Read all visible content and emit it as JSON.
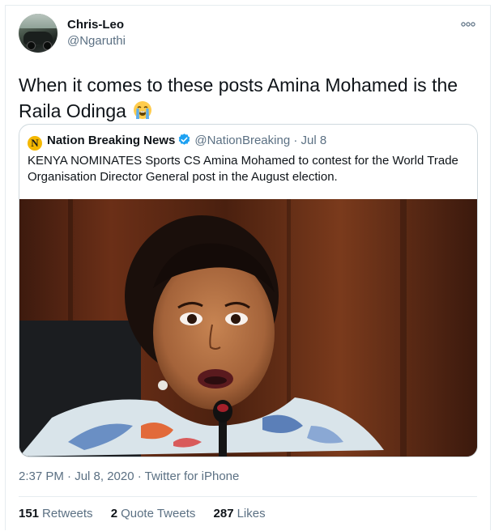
{
  "tweet": {
    "author": {
      "display_name": "Chris-Leo",
      "handle": "@Ngaruthi",
      "avatar_icon": "avatar-car-photo"
    },
    "more_icon": "more-dots-icon",
    "text": "When it comes to these posts Amina Mohamed is the Raila Odinga",
    "emoji": "loudly-crying-face",
    "quoted": {
      "logo_letter": "N",
      "display_name": "Nation Breaking News",
      "verified": true,
      "handle": "@NationBreaking",
      "separator": "·",
      "date": "Jul 8",
      "text": "KENYA NOMINATES Sports CS Amina Mohamed to contest for the World Trade Organisation Director General post in the August election.",
      "photo": "photo of woman speaking into microphone"
    },
    "timestamp": "2:37 PM · Jul 8, 2020 · Twitter for iPhone",
    "stats": {
      "retweets_count": "151",
      "retweets_label": "Retweets",
      "quotes_count": "2",
      "quotes_label": "Quote Tweets",
      "likes_count": "287",
      "likes_label": "Likes"
    }
  },
  "colors": {
    "text_primary": "#0f1419",
    "text_secondary": "#5b7083",
    "verified_blue": "#1da1f2",
    "border": "#cfd9de",
    "logo_yellow": "#f5b800"
  }
}
